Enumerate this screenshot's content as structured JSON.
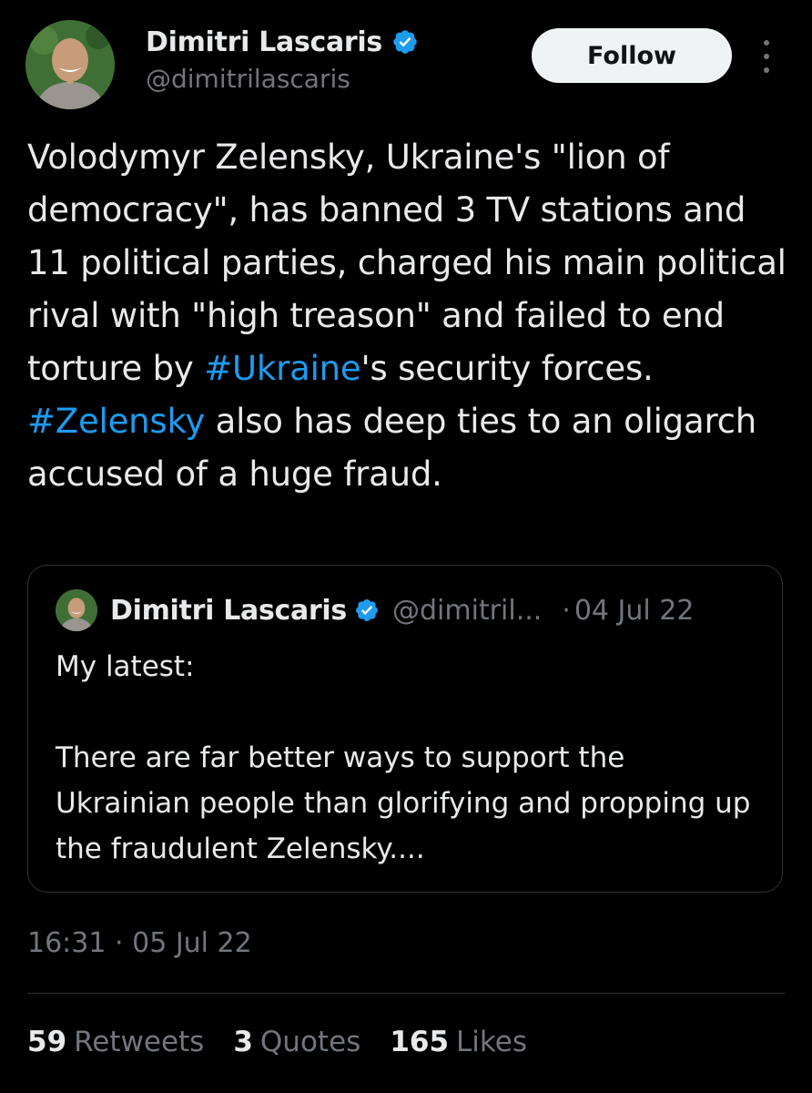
{
  "author": {
    "display_name": "Dimitri Lascaris",
    "handle": "@dimitrilascaris",
    "verified": true
  },
  "follow_button_label": "Follow",
  "tweet": {
    "segments": [
      {
        "text": "Volodymyr Zelensky, Ukraine's \"lion of democracy\", has banned 3 TV stations and 11 political parties, charged his main political rival with \"high treason\" and failed to end torture by ",
        "hashtag": false
      },
      {
        "text": "#Ukraine",
        "hashtag": true
      },
      {
        "text": "'s security forces. ",
        "hashtag": false
      },
      {
        "text": "#Zelensky",
        "hashtag": true
      },
      {
        "text": " also has deep ties to an oligarch accused of a huge fraud.",
        "hashtag": false
      }
    ]
  },
  "quoted_tweet": {
    "display_name": "Dimitri Lascaris",
    "handle": "@dimitril...",
    "separator": "·",
    "date": "04 Jul 22",
    "lines": [
      "My latest:",
      "",
      "There are far better ways to support the Ukrainian people than glorifying and propping up the fraudulent Zelensky...."
    ]
  },
  "timestamp": {
    "time": "16:31",
    "separator": "·",
    "date": "05 Jul 22"
  },
  "stats": {
    "retweets": {
      "count": "59",
      "label": "Retweets"
    },
    "quotes": {
      "count": "3",
      "label": "Quotes"
    },
    "likes": {
      "count": "165",
      "label": "Likes"
    }
  },
  "colors": {
    "background": "#000000",
    "text": "#e7e9ea",
    "secondary": "#71767b",
    "accent": "#1d9bf0",
    "border": "#2f3336"
  }
}
